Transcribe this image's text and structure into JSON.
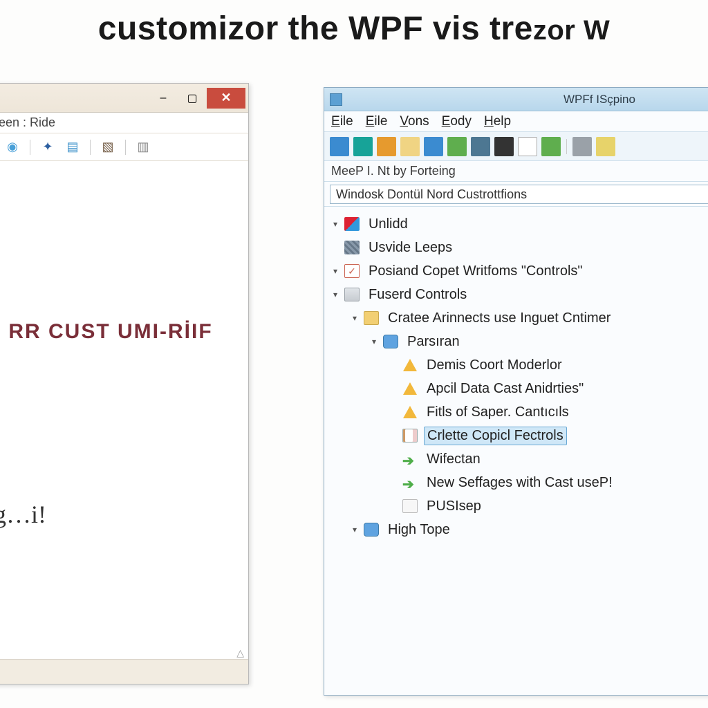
{
  "headline": {
    "part1": "customizor the WPF vis tre",
    "part2": "zor W"
  },
  "left": {
    "menubar_fragment": "› Kieen : Ride",
    "big_text": "RR CUST UMI-RİIF",
    "scribble": "g…i!",
    "sysbuttons": {
      "min": "–",
      "max": "▢",
      "close": "✕"
    },
    "toolbar_icons": [
      {
        "name": "star-icon",
        "glyph": "✶",
        "color": "#c84c3e"
      },
      {
        "name": "pin-icon",
        "glyph": "◉",
        "color": "#49a0d8"
      },
      {
        "name": "divider"
      },
      {
        "name": "puzzle-icon",
        "glyph": "✦",
        "color": "#2c5fa0"
      },
      {
        "name": "card-icon",
        "glyph": "▤",
        "color": "#3a90c9"
      },
      {
        "name": "divider"
      },
      {
        "name": "edit-icon",
        "glyph": "▧",
        "color": "#77604a"
      },
      {
        "name": "divider"
      },
      {
        "name": "list-icon",
        "glyph": "▥",
        "color": "#8a8a8a"
      }
    ]
  },
  "right": {
    "title": "WPFf ISçpino",
    "menus": [
      {
        "label": "Eile",
        "accel": "E"
      },
      {
        "label": "Eile",
        "accel": "E"
      },
      {
        "label": "Vons",
        "accel": "V"
      },
      {
        "label": "Eody",
        "accel": "E"
      },
      {
        "label": "Help",
        "accel": "H"
      }
    ],
    "toolbar": [
      {
        "name": "square-blue",
        "cls": "ic-blue"
      },
      {
        "name": "circle-teal",
        "cls": "ic-teal"
      },
      {
        "name": "circle-orange",
        "cls": "ic-orange"
      },
      {
        "name": "square-folder",
        "cls": "ic-folder"
      },
      {
        "name": "square-blue2",
        "cls": "ic-blue"
      },
      {
        "name": "square-green",
        "cls": "ic-green"
      },
      {
        "name": "square-pic",
        "cls": "ic-pic"
      },
      {
        "name": "square-dark",
        "cls": "ic-dark"
      },
      {
        "name": "square-white",
        "cls": "ic-white"
      },
      {
        "name": "square-green2",
        "cls": "ic-green"
      },
      {
        "name": "divider"
      },
      {
        "name": "square-gray",
        "cls": "ic-gray"
      },
      {
        "name": "square-yellow",
        "cls": "ic-yellow"
      }
    ],
    "infobar": "MeeP I. Nt by Forteing",
    "searchbox": "Windosk Dontül Nord Custrottfions",
    "tree": [
      {
        "depth": 0,
        "exp": "▾",
        "icon": "mix",
        "label": "Unlidd"
      },
      {
        "depth": 0,
        "exp": "",
        "icon": "grid",
        "label": "Usvide Leeps"
      },
      {
        "depth": 0,
        "exp": "▾",
        "icon": "check",
        "label": "Posiand Copet Writfoms \"Controls\""
      },
      {
        "depth": 0,
        "exp": "▾",
        "icon": "stack",
        "label": "Fuserd Controls"
      },
      {
        "depth": 1,
        "exp": "▾",
        "icon": "folder",
        "label": "Cratee Arinnects use Inguet Cntimer"
      },
      {
        "depth": 2,
        "exp": "▾",
        "icon": "blue",
        "label": "Parsıran"
      },
      {
        "depth": 3,
        "exp": "",
        "icon": "warn",
        "label": "Demis Coort Moderlor"
      },
      {
        "depth": 3,
        "exp": "",
        "icon": "warn",
        "label": "Apcil Data Cast Anidrties\""
      },
      {
        "depth": 3,
        "exp": "",
        "icon": "warn",
        "label": "Fitls of Saper. Cantıcıls"
      },
      {
        "depth": 3,
        "exp": "",
        "icon": "doc",
        "label": "Crlette Copicl Fectrols",
        "selected": true
      },
      {
        "depth": 3,
        "exp": "",
        "icon": "arrow",
        "label": "Wifectan"
      },
      {
        "depth": 3,
        "exp": "",
        "icon": "arrow",
        "label": "New Seffages with Cast useP!"
      },
      {
        "depth": 3,
        "exp": "",
        "icon": "page",
        "label": "PUSIsep"
      },
      {
        "depth": 1,
        "exp": "▾",
        "icon": "blue",
        "label": "High Tope"
      }
    ]
  }
}
